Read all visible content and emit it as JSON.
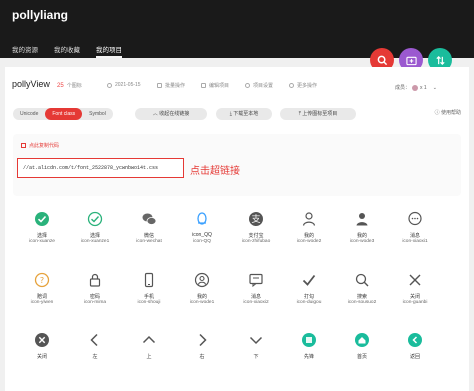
{
  "app": {
    "brand": "pollyliang"
  },
  "nav": {
    "items": [
      "我的资源",
      "我的收藏",
      "我的项目"
    ],
    "active_index": 2
  },
  "fabs": [
    {
      "name": "search-fab",
      "icon": "search-icon",
      "color": "#e53935"
    },
    {
      "name": "add-project-fab",
      "icon": "folder-add-icon",
      "color": "#9b59d0"
    },
    {
      "name": "sort-fab",
      "icon": "arrows-updown-icon",
      "color": "#1abc9c"
    }
  ],
  "project": {
    "name": "pollyView",
    "count": "25",
    "count_unit": "个图标",
    "date": "2021-05-15",
    "actions": [
      "批量操作",
      "编辑项目",
      "项目设置",
      "更多操作"
    ],
    "owner_label": "成员：",
    "owner_count": "x 1"
  },
  "tabs": {
    "items": [
      "Unicode",
      "Font class",
      "Symbol"
    ],
    "active_index": 1
  },
  "buttons": {
    "collapse_link": "收起在线链接",
    "download": "下载至本地",
    "upload": "上传图标至项目"
  },
  "help": "使用帮助",
  "code": {
    "copy_label": "点此复制代码",
    "url": "//at.alicdn.com/t/font_2522878_ycwnbwo14t.css",
    "annotation": "点击超链接"
  },
  "icons": [
    {
      "label": "选择",
      "cls": "icon-xuanze",
      "icon": "check-circle-filled-icon",
      "color": "#2ab27b"
    },
    {
      "label": "选择",
      "cls": "icon-xuanze1",
      "icon": "check-circle-outline-icon",
      "color": "#2ab27b"
    },
    {
      "label": "微信",
      "cls": "icon-wechat",
      "icon": "wechat-icon",
      "color": "#666"
    },
    {
      "label": "icon_QQ",
      "cls": "icon-QQ",
      "icon": "qq-icon",
      "color": "#3aa0ff"
    },
    {
      "label": "支付宝",
      "cls": "icon-zhifubao",
      "icon": "alipay-icon",
      "color": "#555"
    },
    {
      "label": "我的",
      "cls": "icon-wode2",
      "icon": "user-outline-icon",
      "color": "#555"
    },
    {
      "label": "我的",
      "cls": "icon-wode3",
      "icon": "user-filled-icon",
      "color": "#555"
    },
    {
      "label": "消息",
      "cls": "icon-xiaoxi1",
      "icon": "message-icon",
      "color": "#555"
    },
    {
      "label": "赔词",
      "cls": "icon-yiwen",
      "icon": "question-circle-icon",
      "color": "#e6a23c"
    },
    {
      "label": "密码",
      "cls": "icon-mima",
      "icon": "lock-icon",
      "color": "#555"
    },
    {
      "label": "手机",
      "cls": "icon-shouji",
      "icon": "phone-icon",
      "color": "#555"
    },
    {
      "label": "我的",
      "cls": "icon-wode1",
      "icon": "user-circle-icon",
      "color": "#555"
    },
    {
      "label": "消息",
      "cls": "icon-xiaoxi2",
      "icon": "chat-icon",
      "color": "#555"
    },
    {
      "label": "打勾",
      "cls": "icon-duigou",
      "icon": "checkmark-icon",
      "color": "#555"
    },
    {
      "label": "搜索",
      "cls": "icon-sousuo2",
      "icon": "search-icon",
      "color": "#555"
    },
    {
      "label": "关闭",
      "cls": "icon-guanbi",
      "icon": "close-icon",
      "color": "#555"
    },
    {
      "label": "关闭",
      "cls": "",
      "icon": "close-circle-icon",
      "color": "#555"
    },
    {
      "label": "左",
      "cls": "",
      "icon": "chevron-left-icon",
      "color": "#555"
    },
    {
      "label": "上",
      "cls": "",
      "icon": "chevron-up-icon",
      "color": "#555"
    },
    {
      "label": "右",
      "cls": "",
      "icon": "chevron-right-icon",
      "color": "#555"
    },
    {
      "label": "下",
      "cls": "",
      "icon": "chevron-down-icon",
      "color": "#555"
    },
    {
      "label": "先锋",
      "cls": "",
      "icon": "teal-badge-icon",
      "color": "#1abc9c"
    },
    {
      "label": "首页",
      "cls": "",
      "icon": "home-icon",
      "color": "#1abc9c"
    },
    {
      "label": "返回",
      "cls": "",
      "icon": "back-icon",
      "color": "#1abc9c"
    }
  ],
  "colors": {
    "accent": "#e53935",
    "topbar": "#1a1a1a",
    "teal": "#1abc9c"
  }
}
